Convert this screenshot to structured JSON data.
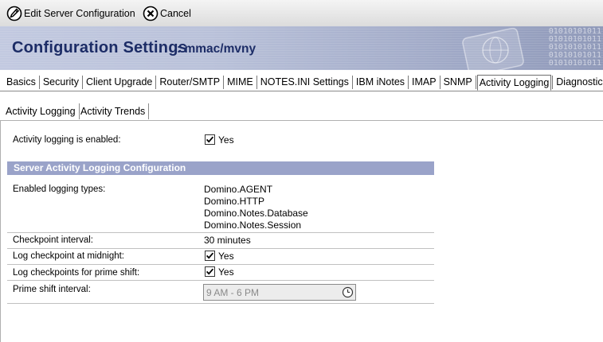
{
  "actions": {
    "edit_label": "Edit Server Configuration",
    "cancel_label": "Cancel"
  },
  "banner": {
    "title": "Configuration Settings",
    "server": ": mmac/mvny",
    "decor": "01010101011"
  },
  "tabs": [
    {
      "label": "Basics"
    },
    {
      "label": "Security"
    },
    {
      "label": "Client Upgrade"
    },
    {
      "label": "Router/SMTP"
    },
    {
      "label": "MIME"
    },
    {
      "label": "NOTES.INI Settings"
    },
    {
      "label": "IBM iNotes"
    },
    {
      "label": "IMAP"
    },
    {
      "label": "SNMP"
    },
    {
      "label": "Activity Logging",
      "active": true
    },
    {
      "label": "Diagnostics"
    }
  ],
  "subtabs": [
    {
      "label": "Activity Logging",
      "active": true
    },
    {
      "label": "Activity Trends"
    }
  ],
  "form": {
    "logging_enabled_label": "Activity logging is enabled:",
    "logging_enabled_value": "Yes",
    "section_title": "Server Activity Logging Configuration",
    "logging_types_label": "Enabled logging types:",
    "logging_types": [
      "Domino.AGENT",
      "Domino.HTTP",
      "Domino.Notes.Database",
      "Domino.Notes.Session"
    ],
    "checkpoint_interval_label": "Checkpoint interval:",
    "checkpoint_interval_value": "30 minutes",
    "midnight_label": "Log checkpoint at midnight:",
    "midnight_value": "Yes",
    "prime_shift_label": "Log checkpoints for prime shift:",
    "prime_shift_value": "Yes",
    "prime_interval_label": "Prime shift interval:",
    "prime_interval_value": "9 AM - 6 PM"
  },
  "colors": {
    "banner_title": "#1c2c66",
    "section_bg": "#9aa3c9"
  },
  "icons": [
    "edit-icon",
    "cancel-icon",
    "checkbox-checked-icon",
    "clock-icon"
  ]
}
